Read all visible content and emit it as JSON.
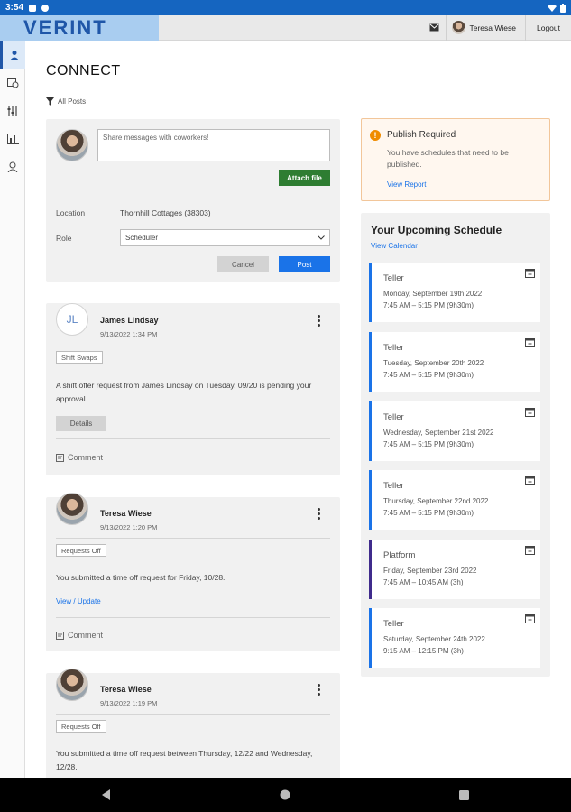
{
  "status_bar": {
    "time": "3:54"
  },
  "header": {
    "logo": "VERINT",
    "user_name": "Teresa Wiese",
    "logout": "Logout"
  },
  "page": {
    "title": "CONNECT",
    "filter": "All Posts"
  },
  "composer": {
    "placeholder": "Share messages with coworkers!",
    "attach": "Attach file",
    "location_label": "Location",
    "location_value": "Thornhill Cottages (38303)",
    "role_label": "Role",
    "role_value": "Scheduler",
    "cancel": "Cancel",
    "post": "Post"
  },
  "posts": [
    {
      "initials": "JL",
      "author": "James Lindsay",
      "time": "9/13/2022 1:34 PM",
      "tag": "Shift Swaps",
      "body": "A shift offer request from James Lindsay on Tuesday, 09/20 is pending your approval.",
      "action": "Details",
      "comment": "Comment"
    },
    {
      "author": "Teresa Wiese",
      "time": "9/13/2022 1:20 PM",
      "tag": "Requests Off",
      "body": "You submitted a time off request for Friday, 10/28.",
      "link": "View / Update",
      "comment": "Comment"
    },
    {
      "author": "Teresa Wiese",
      "time": "9/13/2022 1:19 PM",
      "tag": "Requests Off",
      "body": "You submitted a time off request between Thursday, 12/22 and Wednesday, 12/28."
    }
  ],
  "publish": {
    "title": "Publish Required",
    "message": "You have schedules that need to be published.",
    "link": "View Report"
  },
  "schedule": {
    "title": "Your Upcoming Schedule",
    "link": "View Calendar",
    "shifts": [
      {
        "role": "Teller",
        "date": "Monday, September 19th 2022",
        "time": "7:45 AM – 5:15 PM (9h30m)"
      },
      {
        "role": "Teller",
        "date": "Tuesday, September 20th 2022",
        "time": "7:45 AM – 5:15 PM (9h30m)"
      },
      {
        "role": "Teller",
        "date": "Wednesday, September 21st 2022",
        "time": "7:45 AM – 5:15 PM (9h30m)"
      },
      {
        "role": "Teller",
        "date": "Thursday, September 22nd 2022",
        "time": "7:45 AM – 5:15 PM (9h30m)"
      },
      {
        "role": "Platform",
        "date": "Friday, September 23rd 2022",
        "time": "7:45 AM – 10:45 AM (3h)"
      },
      {
        "role": "Teller",
        "date": "Saturday, September 24th 2022",
        "time": "9:15 AM – 12:15 PM (3h)"
      }
    ]
  },
  "colors": {
    "status_bar": "#1565c0",
    "brand": "#1f56a8",
    "primary_button": "#1a73e8",
    "attach_button": "#2e7d32",
    "warning": "#f08c00"
  }
}
